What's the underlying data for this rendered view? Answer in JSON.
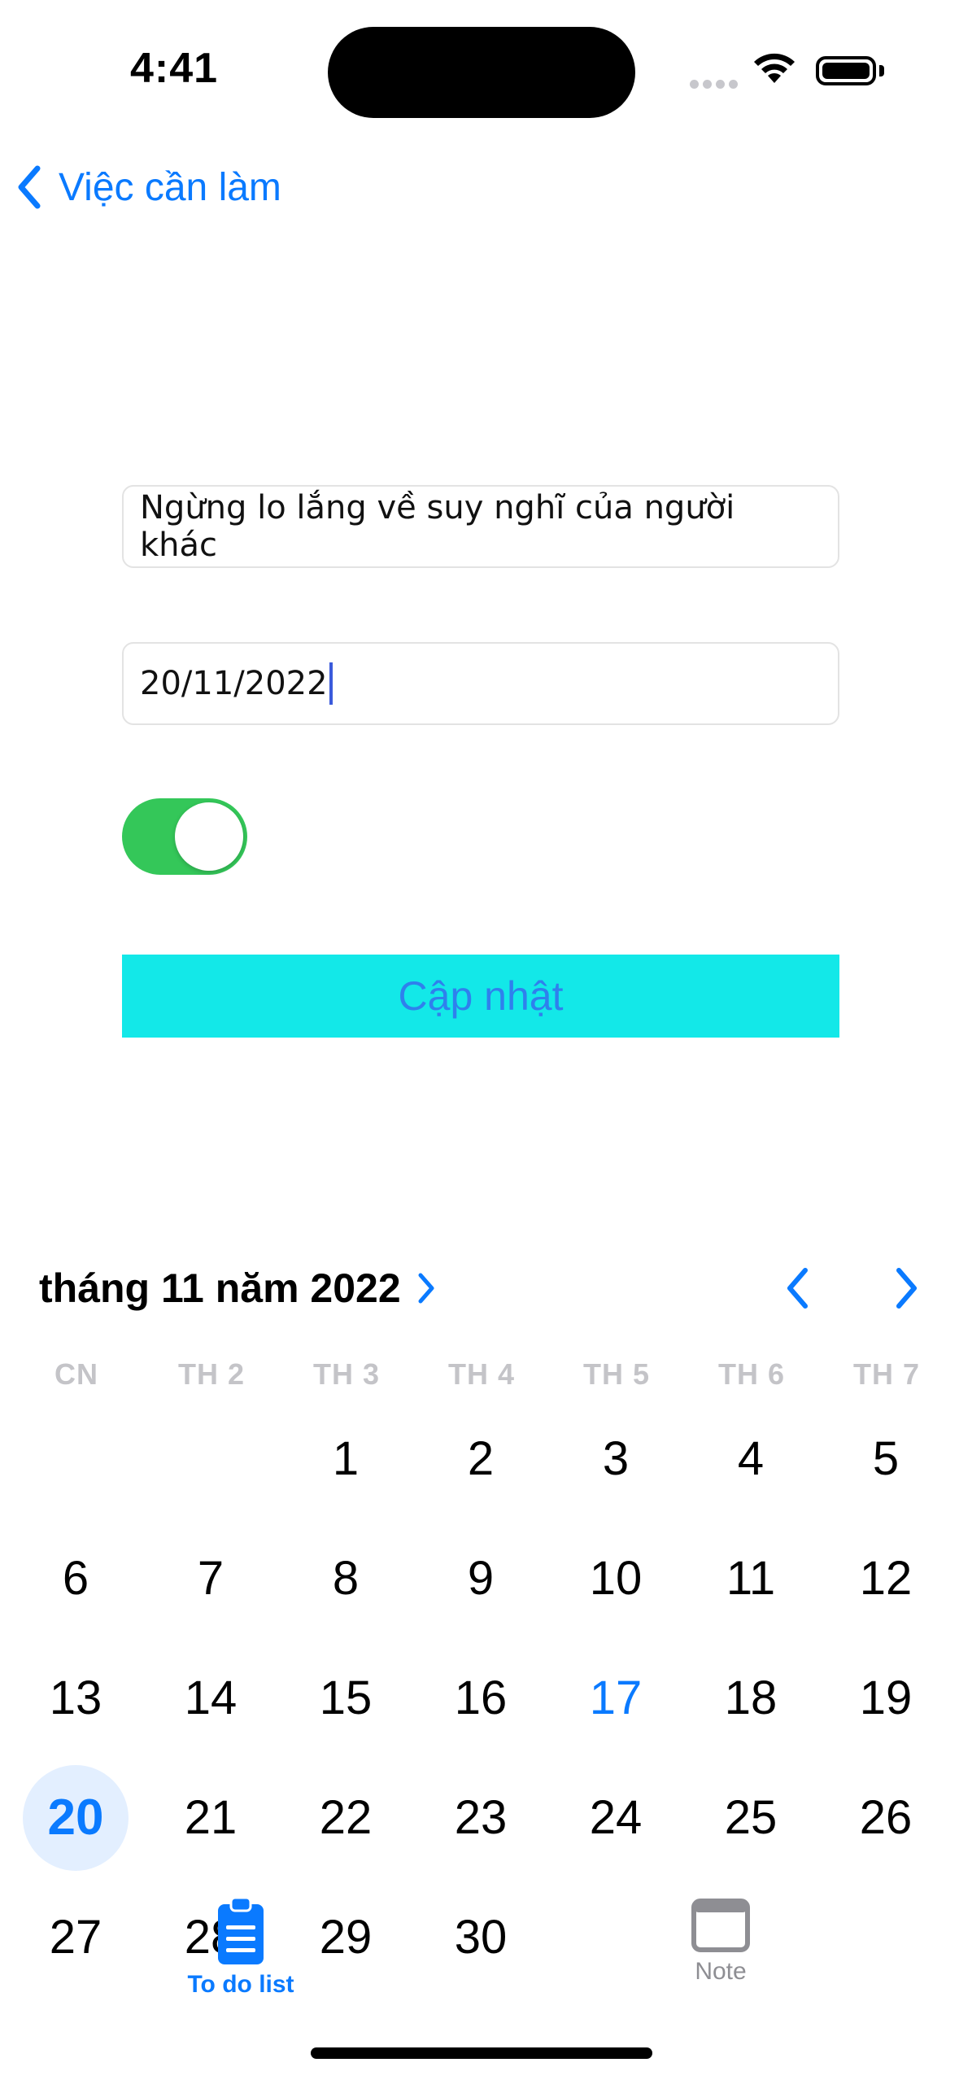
{
  "status_bar": {
    "time": "4:41"
  },
  "nav": {
    "back_label": "Việc cần làm"
  },
  "form": {
    "title_value": "Ngừng lo lắng về suy nghĩ của người khác",
    "date_value": "20/11/2022",
    "toggle_on": true,
    "update_label": "Cập nhật"
  },
  "calendar": {
    "month_title": "tháng 11 năm 2022",
    "weekdays": [
      "CN",
      "TH 2",
      "TH 3",
      "TH 4",
      "TH 5",
      "TH 6",
      "TH 7"
    ],
    "today": 17,
    "selected": 20,
    "days": [
      [
        "1",
        "2",
        "3",
        "4",
        "5"
      ],
      [
        "6",
        "7",
        "8",
        "9",
        "10",
        "11",
        "12"
      ],
      [
        "13",
        "14",
        "15",
        "16",
        "17",
        "18",
        "19"
      ],
      [
        "20",
        "21",
        "22",
        "23",
        "24",
        "25",
        "26"
      ],
      [
        "27",
        "28",
        "29",
        "30"
      ]
    ]
  },
  "tabbar": {
    "tabs": [
      {
        "label": "To do list",
        "icon": "clipboard-list-icon",
        "active": true
      },
      {
        "label": "Note",
        "icon": "window-icon",
        "active": false
      }
    ]
  },
  "colors": {
    "accent": "#0a7aff",
    "toggle": "#34c759",
    "button_bg": "#13e8e8",
    "button_text": "#2f80ed"
  }
}
